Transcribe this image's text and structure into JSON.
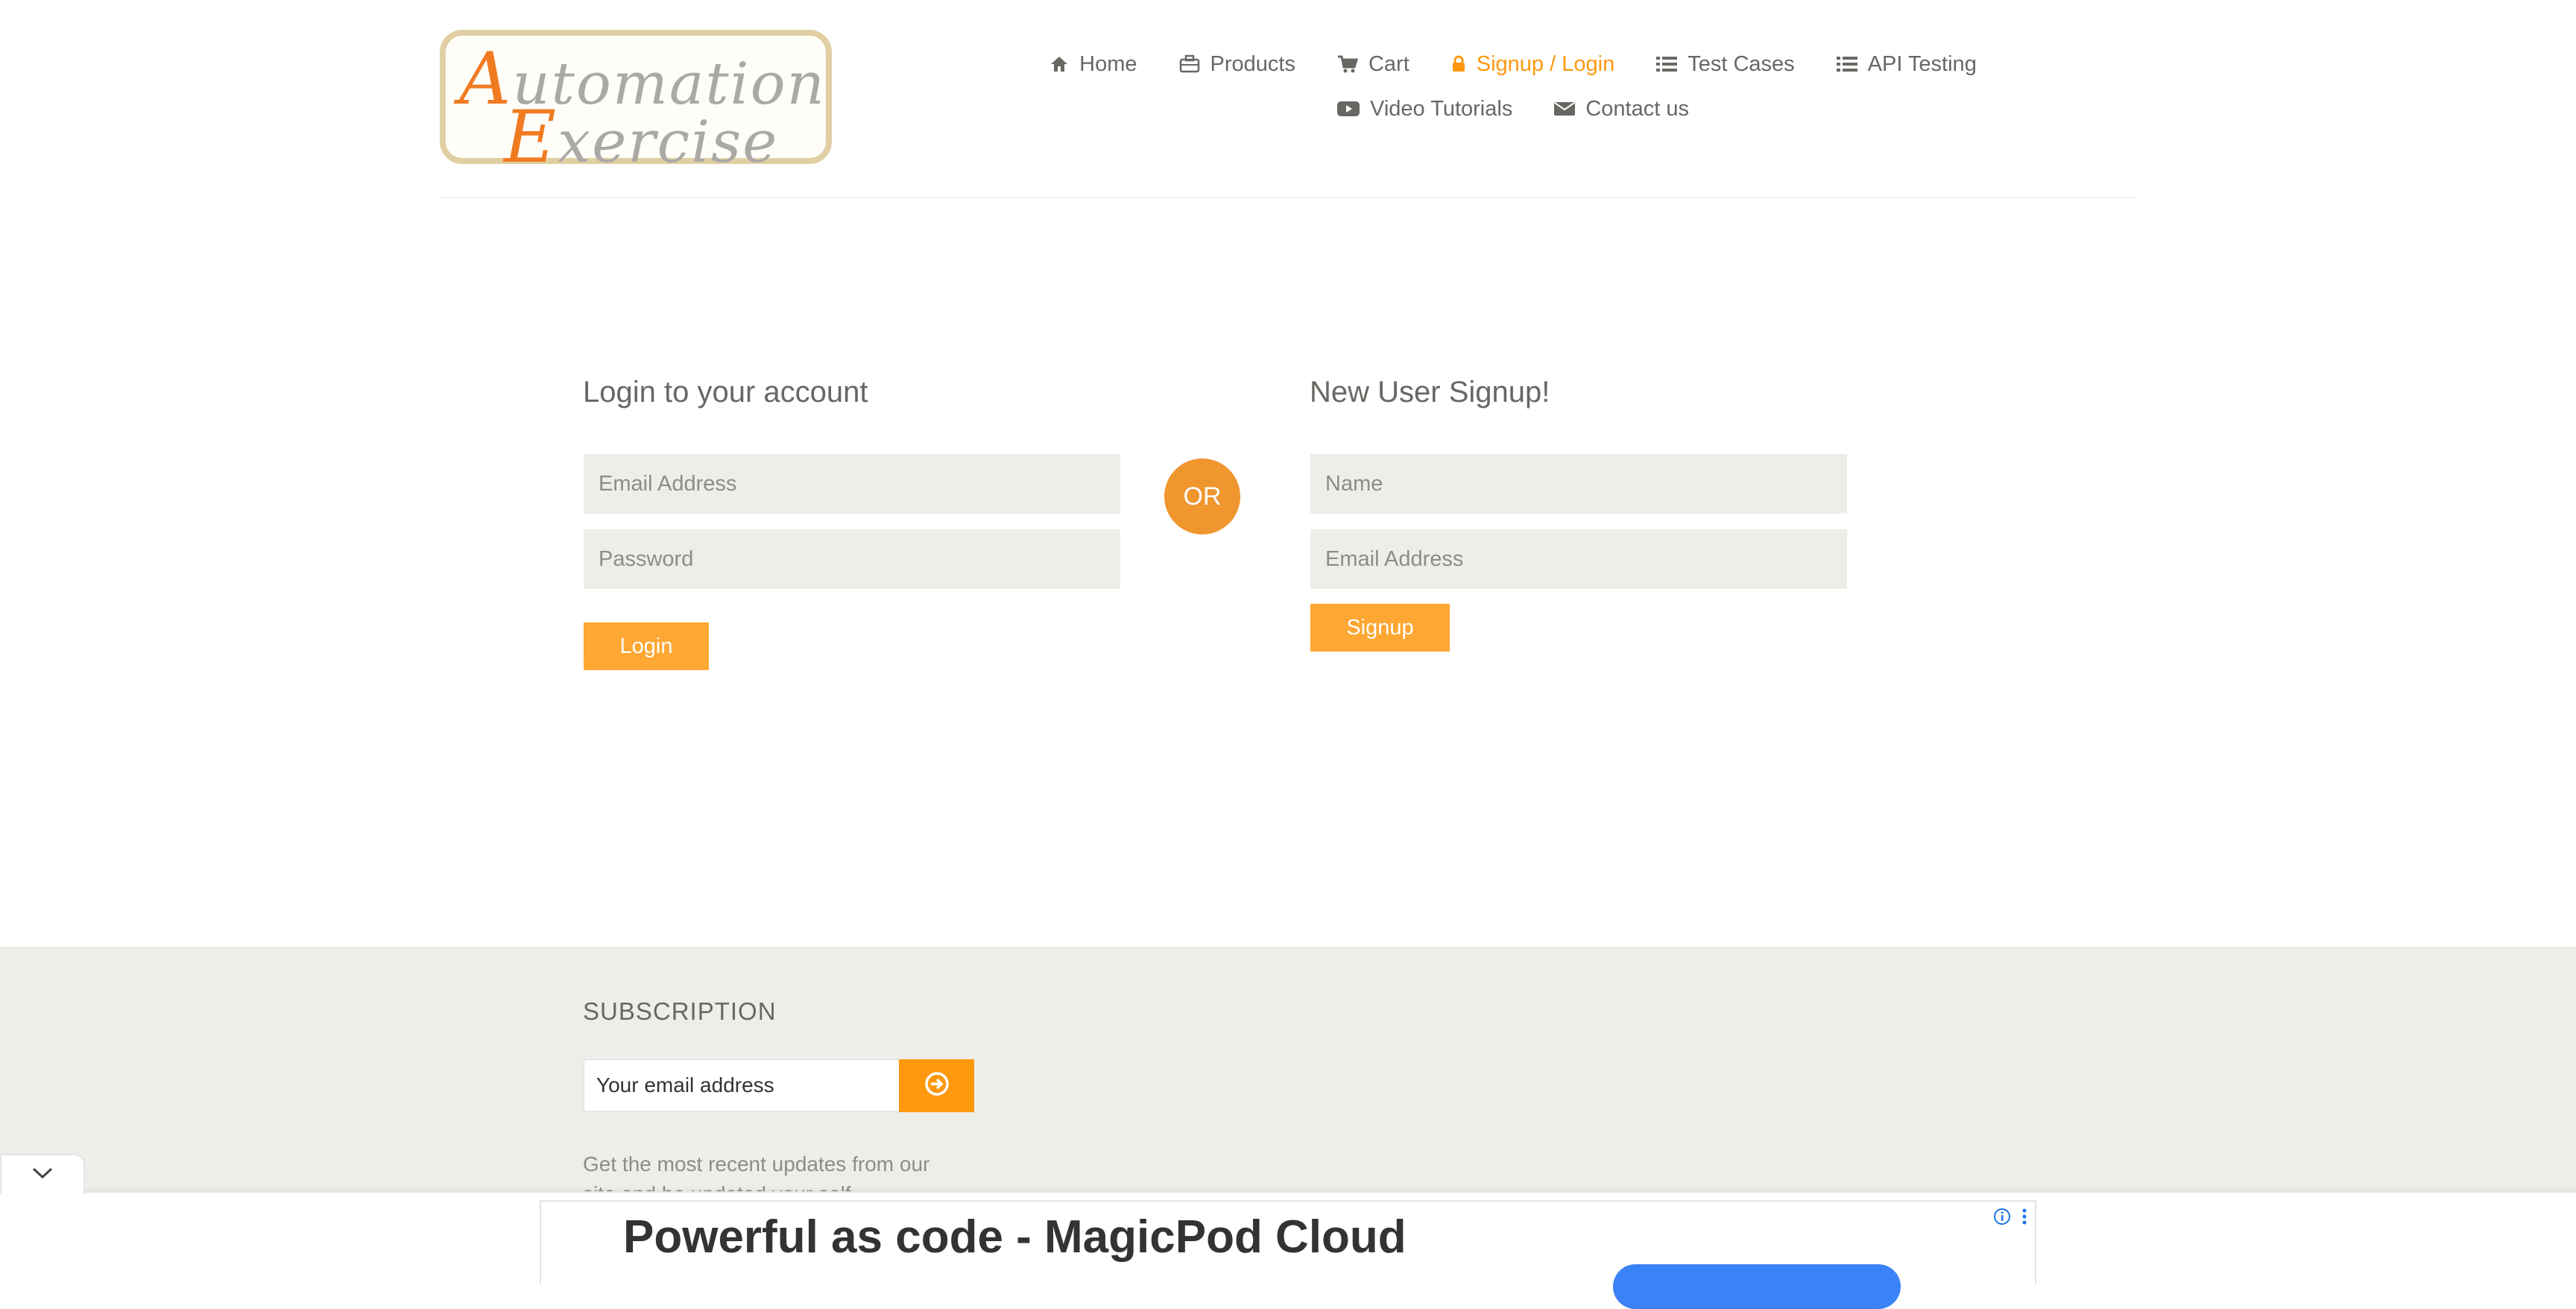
{
  "header": {
    "logo": {
      "line1_cap": "A",
      "line1_rest": "utomation",
      "line2_cap": "E",
      "line2_rest": "xercise"
    },
    "nav": [
      {
        "label": "Home",
        "icon": "home-icon"
      },
      {
        "label": "Products",
        "icon": "briefcase-icon"
      },
      {
        "label": "Cart",
        "icon": "cart-icon"
      },
      {
        "label": "Signup / Login",
        "icon": "lock-icon",
        "active": true
      },
      {
        "label": "Test Cases",
        "icon": "list-icon"
      },
      {
        "label": "API Testing",
        "icon": "list-icon"
      },
      {
        "label": "Video Tutorials",
        "icon": "youtube-icon"
      },
      {
        "label": "Contact us",
        "icon": "envelope-icon"
      }
    ]
  },
  "login": {
    "title": "Login to your account",
    "email_placeholder": "Email Address",
    "password_placeholder": "Password",
    "button_label": "Login"
  },
  "or_label": "OR",
  "signup": {
    "title": "New User Signup!",
    "name_placeholder": "Name",
    "email_placeholder": "Email Address",
    "button_label": "Signup"
  },
  "footer": {
    "subscription_title": "SUBSCRIPTION",
    "email_placeholder": "Your email address",
    "description": "Get the most recent updates from our site and be updated your self..."
  },
  "ad": {
    "headline": "Powerful as code - MagicPod Cloud"
  },
  "colors": {
    "accent": "#fe980f",
    "text": "#696763",
    "field_bg": "#eeeee9",
    "or_circle": "#f0962f"
  }
}
